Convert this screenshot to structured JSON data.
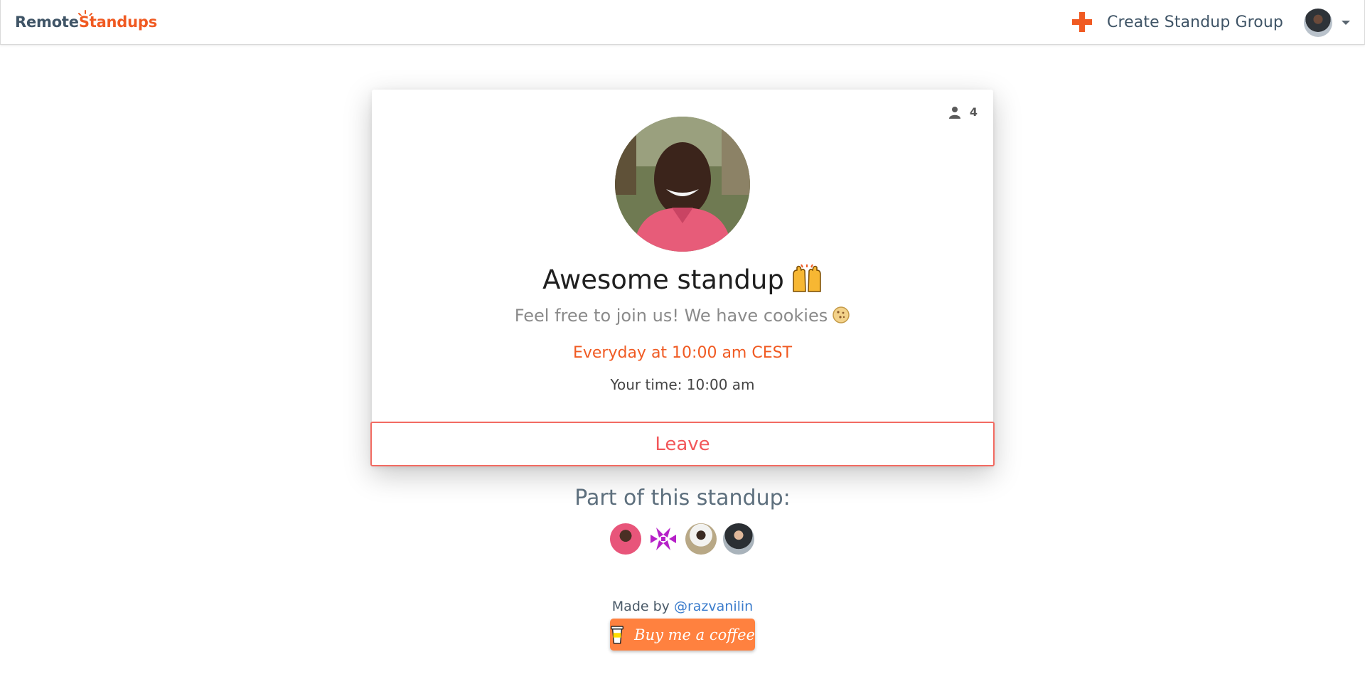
{
  "brand": {
    "part1": "Remote",
    "part2": "Standups"
  },
  "navbar": {
    "create_label": "Create Standup Group",
    "accent_color": "#f05a22"
  },
  "card": {
    "member_count": "4",
    "title": "Awesome standup",
    "title_emoji": "raised-hands-icon",
    "subtitle": "Feel free to join us! We have cookies",
    "subtitle_emoji": "cookie-icon",
    "schedule": "Everyday at 10:00 am CEST",
    "your_time": "Your time: 10:00 am",
    "leave_label": "Leave",
    "leave_color": "#f2575a"
  },
  "members": {
    "heading": "Part of this standup:",
    "avatars": [
      "member-1",
      "member-2",
      "member-3",
      "member-4"
    ]
  },
  "footer": {
    "made_by": "Made by",
    "author": "@razvanilin",
    "coffee_label": "Buy me a coffee",
    "coffee_color": "#ff813f"
  }
}
